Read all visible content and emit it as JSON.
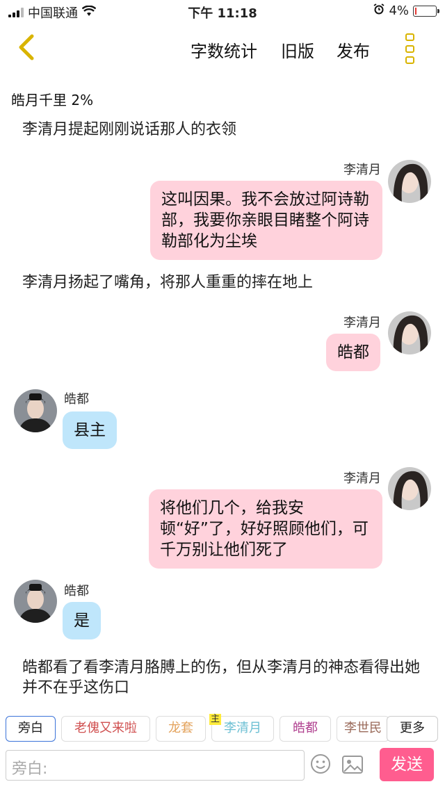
{
  "status_bar": {
    "carrier": "中国联通",
    "time": "下午 11:18",
    "battery": "4%"
  },
  "nav": {
    "word_count": "字数统计",
    "old_version": "旧版",
    "publish": "发布"
  },
  "progress_text": "皓月千里 2%",
  "chat": {
    "n1": "李清月提起刚刚说话那人的衣领",
    "m1_name": "李清月",
    "m1_text": "这叫因果。我不会放过阿诗勒部，我要你亲眼目睹整个阿诗勒部化为尘埃",
    "n2": "李清月扬起了嘴角，将那人重重的摔在地上",
    "m2_name": "李清月",
    "m2_text": "皓都",
    "m3_name": "皓都",
    "m3_text": "县主",
    "m4_name": "李清月",
    "m4_text": "将他们几个，给我安顿“好”了，好好照顾他们，可千万别让他们死了",
    "m5_name": "皓都",
    "m5_text": "是",
    "n3": "皓都看了看李清月胳膊上的伤，但从李清月的神态看得出她并不在乎这伤口"
  },
  "characters": {
    "chips": [
      "旁白",
      "老傀又来啦",
      "龙套",
      "李清月",
      "皓都",
      "李世民"
    ],
    "main_badge": "主",
    "more": "更多"
  },
  "input": {
    "placeholder": "旁白:",
    "send": "发送"
  },
  "colors": {
    "accent_yellow": "#d9b400",
    "send_pink": "#ff5d8f",
    "bubble_pink": "#ffd2dc",
    "bubble_blue": "#bfe6fb"
  }
}
